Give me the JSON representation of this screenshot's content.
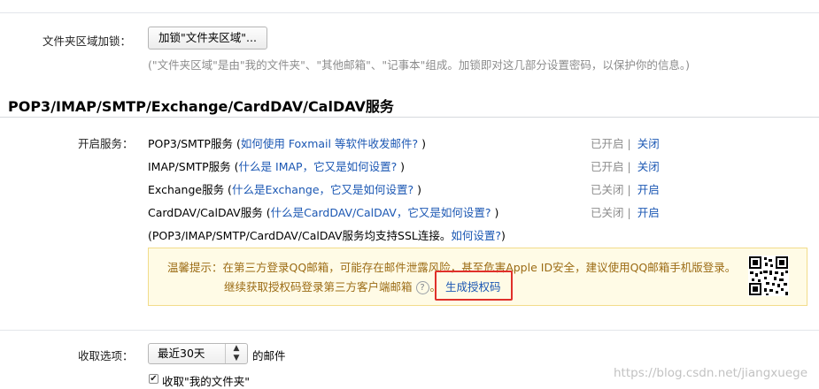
{
  "folder_lock": {
    "label": "文件夹区域加锁：",
    "button": "加锁\"文件夹区域\"...",
    "note": "(\"文件夹区域\"是由\"我的文件夹\"、\"其他邮箱\"、\"记事本\"组成。加锁即对这几部分设置密码，以保护你的信息。)"
  },
  "section": {
    "title": "POP3/IMAP/SMTP/Exchange/CardDAV/CalDAV服务"
  },
  "services": {
    "label": "开启服务：",
    "rows": [
      {
        "name": "POP3/SMTP服务",
        "open": " (",
        "help": "如何使用 Foxmail 等软件收发邮件?",
        "close": " )",
        "status": "已开启",
        "action": "关闭"
      },
      {
        "name": "IMAP/SMTP服务",
        "open": " (",
        "help": "什么是 IMAP，它又是如何设置?",
        "close": " )",
        "status": "已开启",
        "action": "关闭"
      },
      {
        "name": "Exchange服务",
        "open": " (",
        "help": "什么是Exchange，它又是如何设置?",
        "close": " )",
        "status": "已关闭",
        "action": "开启"
      },
      {
        "name": "CardDAV/CalDAV服务",
        "open": " (",
        "help": "什么是CardDAV/CalDAV，它又是如何设置?",
        "close": " )",
        "status": "已关闭",
        "action": "开启"
      }
    ],
    "separator": "|",
    "ssl_note_prefix": "(POP3/IMAP/SMTP/CardDAV/CalDAV服务均支持SSL连接。",
    "ssl_note_link": "如何设置?",
    "ssl_note_suffix": ")"
  },
  "notice": {
    "title": "温馨提示：",
    "line1": "在第三方登录QQ邮箱，可能存在邮件泄露风险，甚至危害Apple ID安全，建议使用QQ邮箱手机版登录。",
    "line2": "继续获取授权码登录第三方客户端邮箱",
    "help_mark": "?",
    "period": "。",
    "generate_link": "生成授权码"
  },
  "receive": {
    "label": "收取选项：",
    "select_value": "最近30天",
    "suffix": "的邮件",
    "checkbox_label": "收取\"我的文件夹\"",
    "checkbox_checked": true
  },
  "watermark": "https://blog.csdn.net/jiangxuege"
}
